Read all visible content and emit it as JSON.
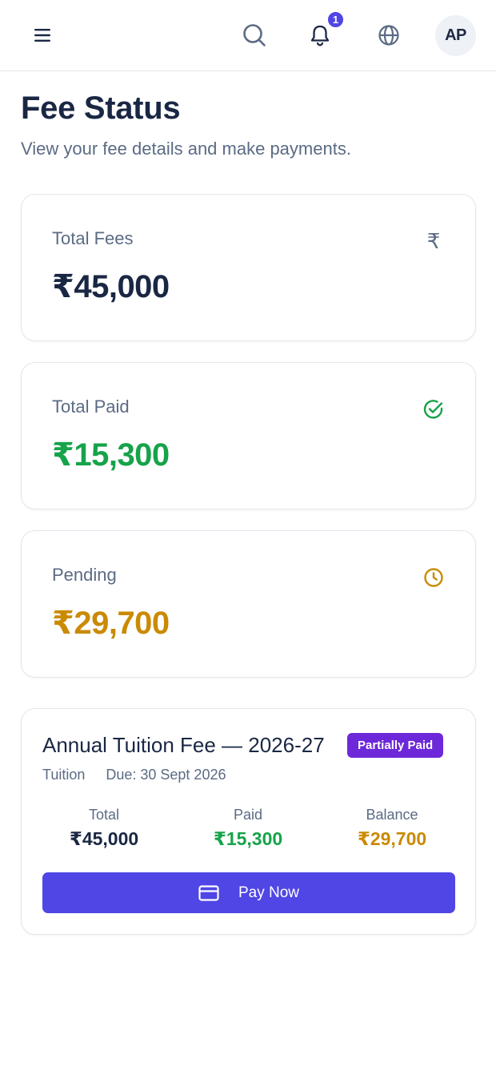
{
  "header": {
    "notification_count": "1",
    "avatar_initials": "AP"
  },
  "page": {
    "title": "Fee Status",
    "subtitle": "View your fee details and make payments."
  },
  "stats": [
    {
      "label": "Total Fees",
      "value": "₹45,000",
      "icon": "rupee-icon",
      "color": "#1a2744"
    },
    {
      "label": "Total Paid",
      "value": "₹15,300",
      "icon": "check-circle-icon",
      "color": "#16a34a"
    },
    {
      "label": "Pending",
      "value": "₹29,700",
      "icon": "clock-icon",
      "color": "#ca8a04"
    }
  ],
  "fee_item": {
    "title": "Annual Tuition Fee — 2026-27",
    "status": "Partially Paid",
    "category": "Tuition",
    "due": "Due: 30 Sept 2026",
    "columns": [
      {
        "label": "Total",
        "value": "₹45,000",
        "color": "#1a2744"
      },
      {
        "label": "Paid",
        "value": "₹15,300",
        "color": "#16a34a"
      },
      {
        "label": "Balance",
        "value": "₹29,700",
        "color": "#ca8a04"
      }
    ],
    "pay_label": "Pay Now"
  },
  "colors": {
    "accent": "#4f46e5",
    "badge": "#6d28d9",
    "success": "#16a34a",
    "warning": "#ca8a04"
  }
}
